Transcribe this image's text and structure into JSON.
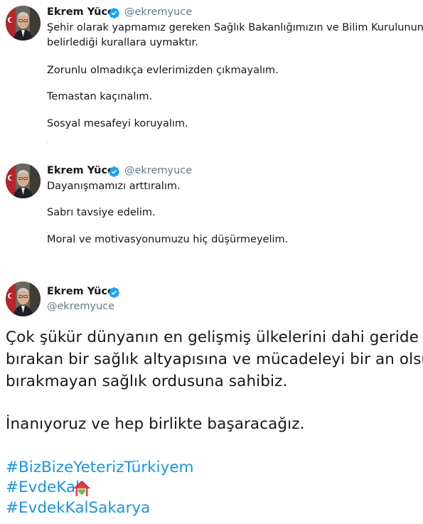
{
  "tweets": [
    {
      "author_name": "Ekrem Yüce",
      "author_handle": "@ekremyuce",
      "lines": [
        "Şehir olarak yapmamız gereken Sağlık Bakanlığımızın ve Bilim Kurulunun",
        "belirlediği kurallara uymaktır.",
        "Zorunlu olmadıkça evlerimizden çıkmayalım.",
        "Temastan kaçınalım.",
        "Sosyal mesafeyi koruyalım."
      ]
    },
    {
      "author_name": "Ekrem Yüce",
      "author_handle": "@ekremyuce",
      "lines": [
        "Dayanışmamızı arttıralım.",
        "Sabrı tavsiye edelim.",
        "Moral ve motivasyonumuzu hiç düşürmeyelim."
      ]
    }
  ],
  "main_tweet": {
    "author_name": "Ekrem Yüce",
    "author_handle": "@ekremyuce",
    "paragraph_lines": [
      "Çok şükür dünyanın en gelişmiş ülkelerini dahi geride",
      "bırakan bir sağlık altyapısına ve mücadeleyi bir an olsun",
      "bırakmayan sağlık ordusuna sahibiz."
    ],
    "line2": "İnanıyoruz ve hep birlikte başaracağız.",
    "hashtags": [
      "#BizBizeYeterizTürkiyem",
      "#EvdeKal",
      "#EvdekKalSakarya"
    ]
  },
  "icons": {
    "verified": "verified-badge-icon",
    "house": "house-with-heart-emoji-icon"
  },
  "colors": {
    "link": "#1b95e0",
    "verified": "#1da1f2",
    "handle": "#657786"
  }
}
